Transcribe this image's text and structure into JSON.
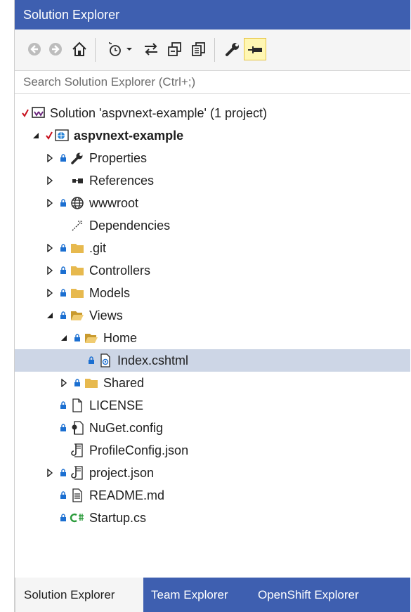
{
  "panel": {
    "title": "Solution Explorer"
  },
  "toolbar": {
    "buttons": [
      "back",
      "forward",
      "home",
      "pending-changes-filter",
      "dropdown",
      "sync-with-active-document",
      "collapse-all",
      "show-all-files",
      "properties",
      "preview-selected-items"
    ]
  },
  "search": {
    "placeholder": "Search Solution Explorer (Ctrl+;)"
  },
  "tree": {
    "solution": "Solution 'aspvnext-example' (1 project)",
    "project": "aspvnext-example",
    "items": {
      "properties": "Properties",
      "references": "References",
      "wwwroot": "wwwroot",
      "dependencies": "Dependencies",
      "git": ".git",
      "controllers": "Controllers",
      "models": "Models",
      "views": "Views",
      "home": "Home",
      "index": "Index.cshtml",
      "shared": "Shared",
      "license": "LICENSE",
      "nuget": "NuGet.config",
      "profileconfig": "ProfileConfig.json",
      "projectjson": "project.json",
      "readme": "README.md",
      "startup": "Startup.cs"
    }
  },
  "tabs": [
    "Solution Explorer",
    "Team Explorer",
    "OpenShift Explorer"
  ],
  "colors": {
    "titlebar": "#3e5fb0",
    "selected_row": "#cdd6e6",
    "lock": "#1b6fd1",
    "folder": "#e7b94e",
    "check": "#c8101d"
  }
}
